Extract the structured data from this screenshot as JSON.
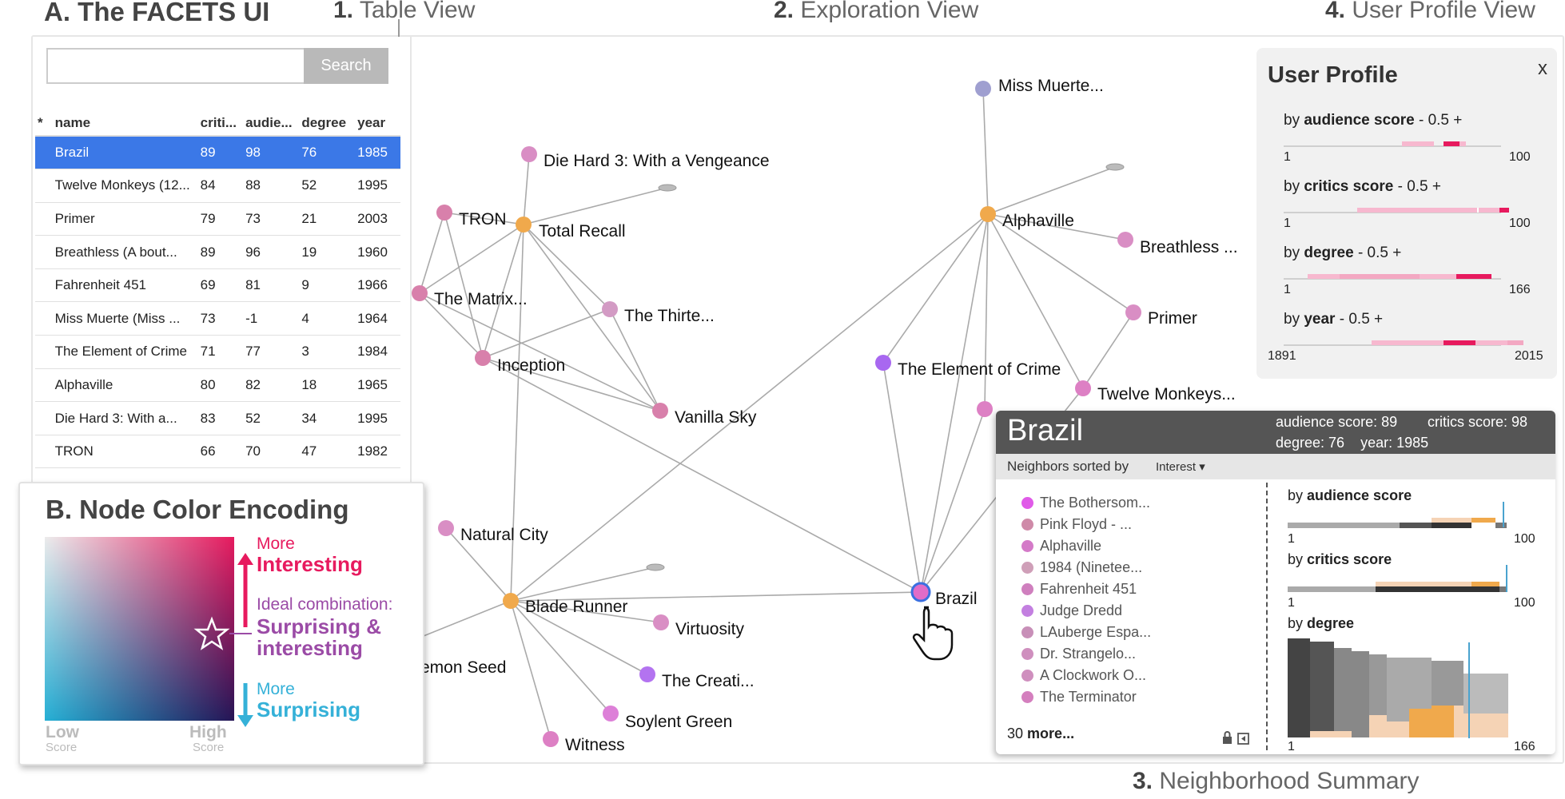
{
  "labels": {
    "title": "A. The FACETS UI",
    "v1_num": "1.",
    "v1_text": "Table View",
    "v2_num": "2.",
    "v2_text": "Exploration View",
    "v4_num": "4.",
    "v4_text": "User Profile View",
    "v3_num": "3.",
    "v3_text": "Neighborhood Summary"
  },
  "table": {
    "search_value": "",
    "search_label": "Search",
    "columns": [
      "*",
      "name",
      "criti...",
      "audie...",
      "degree",
      "year"
    ],
    "rows": [
      [
        "",
        "Brazil",
        "89",
        "98",
        "76",
        "1985"
      ],
      [
        "",
        "Twelve Monkeys (12...",
        "84",
        "88",
        "52",
        "1995"
      ],
      [
        "",
        "Primer",
        "79",
        "73",
        "21",
        "2003"
      ],
      [
        "",
        "Breathless (A bout...",
        "89",
        "96",
        "19",
        "1960"
      ],
      [
        "",
        "Fahrenheit 451",
        "69",
        "81",
        "9",
        "1966"
      ],
      [
        "",
        "Miss Muerte (Miss ...",
        "73",
        "-1",
        "4",
        "1964"
      ],
      [
        "",
        "The Element of Crime",
        "71",
        "77",
        "3",
        "1984"
      ],
      [
        "",
        "Alphaville",
        "80",
        "82",
        "18",
        "1965"
      ],
      [
        "",
        "Die Hard 3: With a...",
        "83",
        "52",
        "34",
        "1995"
      ],
      [
        "",
        "TRON",
        "66",
        "70",
        "47",
        "1982"
      ]
    ],
    "selected_row": 0,
    "selected_color": "#3b78e7"
  },
  "graph": {
    "nodes": [
      {
        "id": "miss",
        "label": "Miss Muerte...",
        "color": "#9f9fd0"
      },
      {
        "id": "diehard",
        "label": "Die Hard 3: With a Vengeance",
        "color": "#d98ec4"
      },
      {
        "id": "tron",
        "label": "TRON",
        "color": "#d880ab"
      },
      {
        "id": "totalrecall",
        "label": "Total Recall",
        "color": "#f0a94c"
      },
      {
        "id": "alphaville",
        "label": "Alphaville",
        "color": "#f0a94c"
      },
      {
        "id": "breathless",
        "label": "Breathless ...",
        "color": "#d98ec4"
      },
      {
        "id": "matrix",
        "label": "The Matrix...",
        "color": "#d880ab"
      },
      {
        "id": "thirte",
        "label": "The Thirte...",
        "color": "#d39bc4"
      },
      {
        "id": "primer",
        "label": "Primer",
        "color": "#d98ec4"
      },
      {
        "id": "inception",
        "label": "Inception",
        "color": "#d880ab"
      },
      {
        "id": "element",
        "label": "The Element of Crime",
        "color": "#a868f0"
      },
      {
        "id": "twelve",
        "label": "Twelve Monkeys...",
        "color": "#dd80c4"
      },
      {
        "id": "vanilla",
        "label": "Vanilla Sky",
        "color": "#d880ab"
      },
      {
        "id": "natural",
        "label": "Natural City",
        "color": "#d98ec4"
      },
      {
        "id": "bladerunner",
        "label": "Blade Runner",
        "color": "#f0a94c"
      },
      {
        "id": "virtuosity",
        "label": "Virtuosity",
        "color": "#d98ec4"
      },
      {
        "id": "brazil",
        "label": "Brazil",
        "color": "#e06cc8"
      },
      {
        "id": "lemon",
        "label": "emon Seed",
        "color": "#d98ec4"
      },
      {
        "id": "creati",
        "label": "The Creati...",
        "color": "#b373f0"
      },
      {
        "id": "soylent",
        "label": "Soylent Green",
        "color": "#dd80d8"
      },
      {
        "id": "witness",
        "label": "Witness",
        "color": "#dd80c4"
      },
      {
        "id": "hidden1",
        "label": "",
        "color": "#dd80c4"
      }
    ],
    "edge_color": "#aaaaaa"
  },
  "color_encoding": {
    "title": "B. Node Color Encoding",
    "more_top": "More",
    "interesting": "Interesting",
    "ideal": "Ideal combination:",
    "surprising_and": "Surprising &",
    "interesting2": "interesting",
    "more_bottom": "More",
    "surprising": "Surprising",
    "low": "Low",
    "high": "High",
    "score": "Score",
    "pink": "#e71a5e",
    "purple": "#9b4ba6",
    "blue": "#35b1d8"
  },
  "user_profile": {
    "title": "User Profile",
    "close": "x",
    "rows": [
      {
        "prefix": "by ",
        "attr": "audience score",
        "suffix": " - 0.5 +",
        "min": "1",
        "max": "100"
      },
      {
        "prefix": "by ",
        "attr": "critics score",
        "suffix": " - 0.5 +",
        "min": "1",
        "max": "100"
      },
      {
        "prefix": "by ",
        "attr": "degree",
        "suffix": " - 0.5 +",
        "min": "1",
        "max": "166"
      },
      {
        "prefix": "by ",
        "attr": "year",
        "suffix": " - 0.5 +",
        "min": "1891",
        "max": "2015"
      }
    ]
  },
  "neighborhood": {
    "title": "Brazil",
    "stats_line1_a": "audience  score: 89",
    "stats_line1_b": "critics  score: 98",
    "stats_line2": "degree: 76    year: 1985",
    "sorted_by": "Neighbors sorted by",
    "sort_value": "Interest",
    "items": [
      {
        "label": "The Bothersom...",
        "color": "#e05ae8"
      },
      {
        "label": "Pink Floyd - ...",
        "color": "#cf8aa8"
      },
      {
        "label": "Alphaville",
        "color": "#d47ac8"
      },
      {
        "label": "1984 (Ninetee...",
        "color": "#cf9fb8"
      },
      {
        "label": "Fahrenheit 451",
        "color": "#cf7fbe"
      },
      {
        "label": "Judge Dredd",
        "color": "#c37fe0"
      },
      {
        "label": "LAuberge Espa...",
        "color": "#c88fb8"
      },
      {
        "label": "Dr. Strangelo...",
        "color": "#cf8fbe"
      },
      {
        "label": "A Clockwork O...",
        "color": "#cf8fbe"
      },
      {
        "label": "The Terminator",
        "color": "#d47fbe"
      }
    ],
    "more_count": "30",
    "more_label": "more...",
    "charts": [
      {
        "prefix": "by ",
        "attr": "audience score",
        "min": "1",
        "max": "100"
      },
      {
        "prefix": "by ",
        "attr": "critics score",
        "min": "1",
        "max": "100"
      },
      {
        "prefix": "by ",
        "attr": "degree",
        "min": "1",
        "max": "166"
      }
    ],
    "highlight_color": "#4aa3cf",
    "neighbor_color": "#f0a94c"
  }
}
